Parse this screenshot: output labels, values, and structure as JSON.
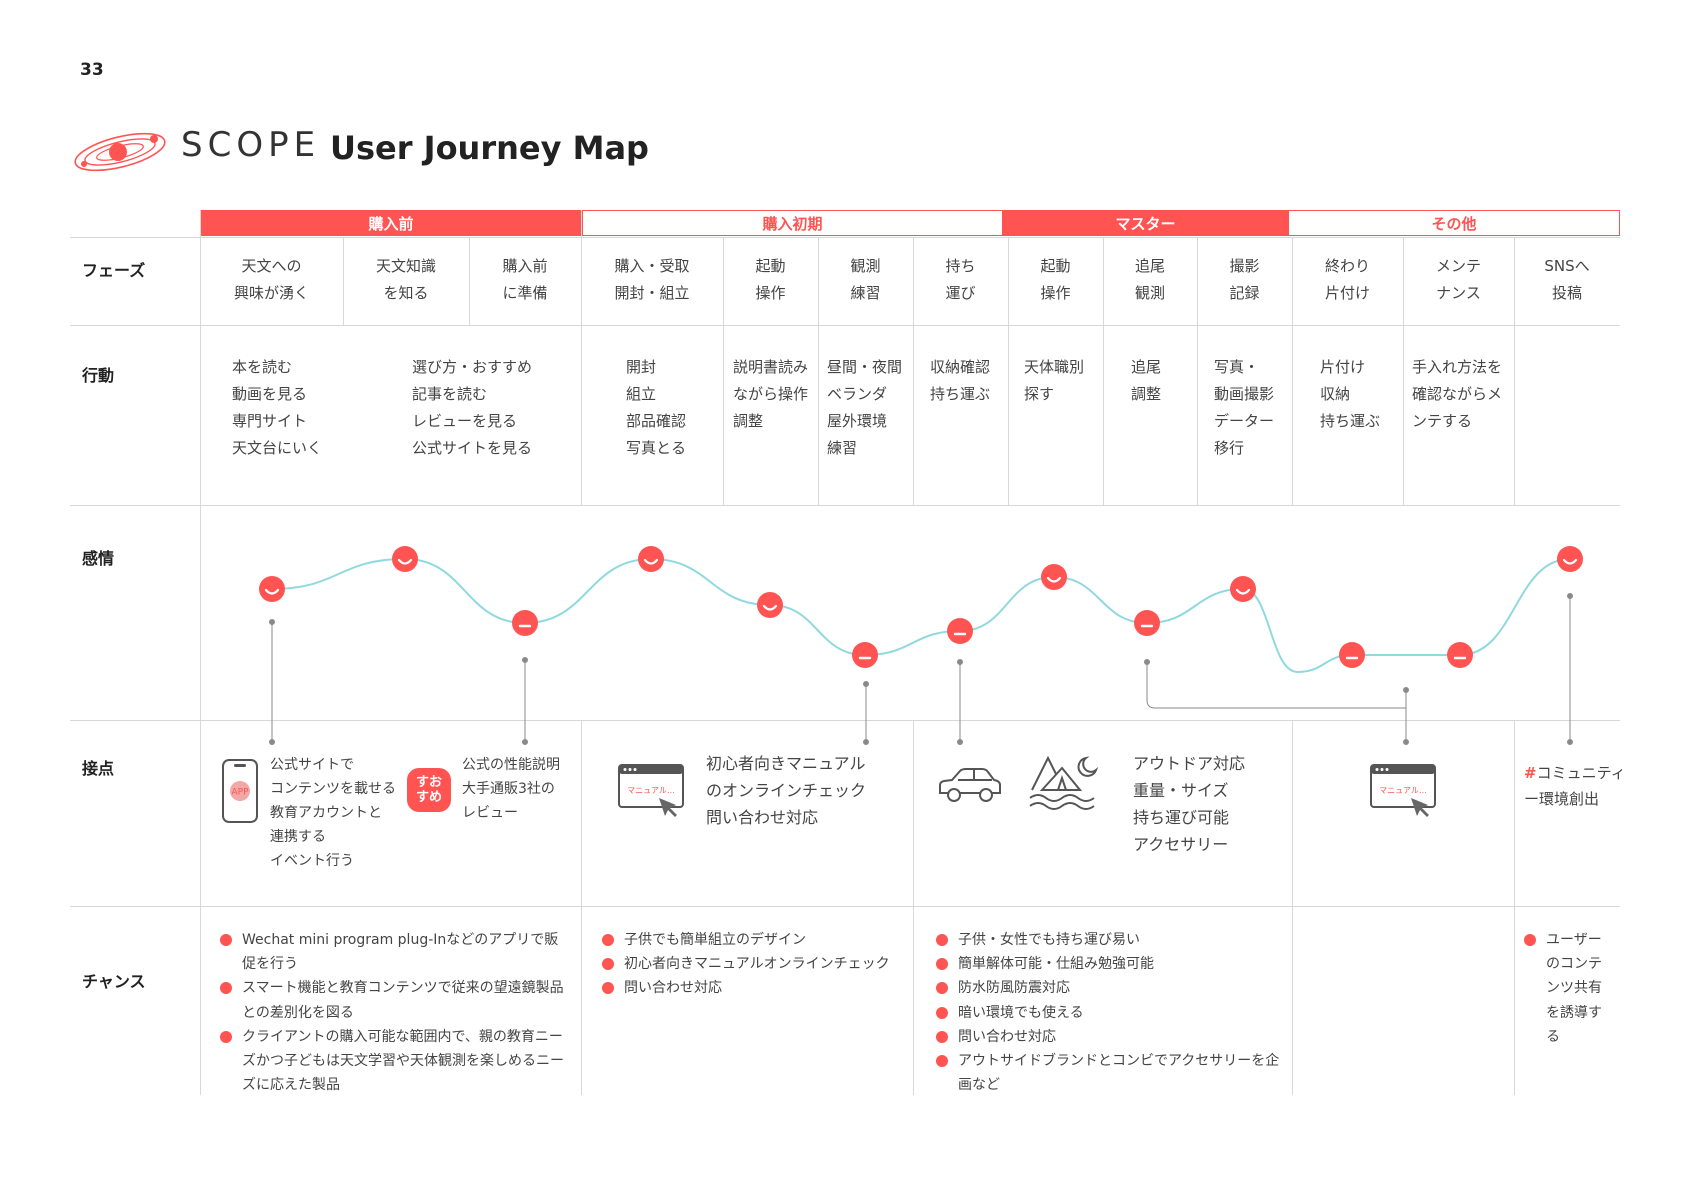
{
  "page_number": "33",
  "brand": "SCOPE",
  "title": "User Journey Map",
  "stages": [
    {
      "label": "購入前",
      "style": "filled"
    },
    {
      "label": "購入初期",
      "style": "outline"
    },
    {
      "label": "マスター",
      "style": "filled"
    },
    {
      "label": "その他",
      "style": "outline"
    }
  ],
  "row_labels": {
    "phase": "フェーズ",
    "action": "行動",
    "emotion": "感情",
    "touchpoint": "接点",
    "chance": "チャンス"
  },
  "phases": [
    [
      "天文への",
      "興味が湧く"
    ],
    [
      "天文知識",
      "を知る"
    ],
    [
      "購入前",
      "に準備"
    ],
    [
      "購入・受取",
      "開封・組立"
    ],
    [
      "起動",
      "操作"
    ],
    [
      "観測",
      "練習"
    ],
    [
      "持ち",
      "運び"
    ],
    [
      "起動",
      "操作"
    ],
    [
      "追尾",
      "観測"
    ],
    [
      "撮影",
      "記録"
    ],
    [
      "終わり",
      "片付け"
    ],
    [
      "メンテ",
      "ナンス"
    ],
    [
      "SNSへ",
      "投稿"
    ]
  ],
  "actions": [
    [
      "本を読む",
      "動画を見る",
      "専門サイト",
      "天文台にいく"
    ],
    [
      "選び方・おすすめ",
      "記事を読む",
      "レビューを見る",
      "公式サイトを見る"
    ],
    [
      "開封",
      "組立",
      "部品確認",
      "写真とる"
    ],
    [
      "説明書読み",
      "ながら操作",
      "調整"
    ],
    [
      "昼間・夜間",
      "ベランダ",
      "屋外環境",
      "練習"
    ],
    [
      "収納確認",
      "持ち運ぶ"
    ],
    [
      "天体職別",
      "探す"
    ],
    [
      "追尾",
      "調整"
    ],
    [
      "写真・",
      "動画撮影",
      "データー",
      "移行"
    ],
    [
      "片付け",
      "収納",
      "持ち運ぶ"
    ],
    [
      "手入れ方法を",
      "確認ながらメ",
      "ンテする"
    ]
  ],
  "emotion_points": [
    {
      "mood": "happy"
    },
    {
      "mood": "happy"
    },
    {
      "mood": "neutral"
    },
    {
      "mood": "happy"
    },
    {
      "mood": "happy"
    },
    {
      "mood": "neutral"
    },
    {
      "mood": "neutral"
    },
    {
      "mood": "happy"
    },
    {
      "mood": "neutral"
    },
    {
      "mood": "happy"
    },
    {
      "mood": "neutral"
    },
    {
      "mood": "neutral"
    },
    {
      "mood": "happy"
    }
  ],
  "touchpoints": {
    "app_icon_text": "APP",
    "recommend_badge": [
      "すお",
      "すめ"
    ],
    "app_text": [
      "公式サイトで",
      "コンテンツを載せる",
      "教育アカウントと",
      "連携する",
      "イベント行う"
    ],
    "review_text": [
      "公式の性能説明",
      "大手通販3社の",
      "レビュー"
    ],
    "manual_label": "マニュアル…",
    "manual_text": [
      "初心者向きマニュアル",
      "のオンラインチェック",
      "問い合わせ対応"
    ],
    "outdoor_text": [
      "アウトドア対応",
      "重量・サイズ",
      "持ち運び可能",
      "アクセサリー"
    ],
    "community_hash": "#",
    "community_text": [
      "コミュニティ",
      "ー環境創出"
    ]
  },
  "chances": [
    [
      "Wechat mini program plug-Inなどのアプリで販促を行う",
      "スマート機能と教育コンテンツで従来の望遠鏡製品との差別化を図る",
      "クライアントの購入可能な範囲内で、親の教育ニーズかつ子どもは天文学習や天体観測を楽しめるニーズに応えた製品"
    ],
    [
      "子供でも簡単組立のデザイン",
      "初心者向きマニュアルオンラインチェック",
      "問い合わせ対応"
    ],
    [
      "子供・女性でも持ち運び易い",
      "簡単解体可能・仕組み勉強可能",
      "防水防風防震対応",
      "暗い環境でも使える",
      "問い合わせ対応",
      "アウトサイドブランドとコンビでアクセサリーを企画など"
    ],
    [],
    [
      "ユーザーのコンテンツ共有を誘導する"
    ]
  ],
  "colors": {
    "accent": "#ff5452",
    "curve": "#8fd9df",
    "grid": "#d8d8d8"
  }
}
